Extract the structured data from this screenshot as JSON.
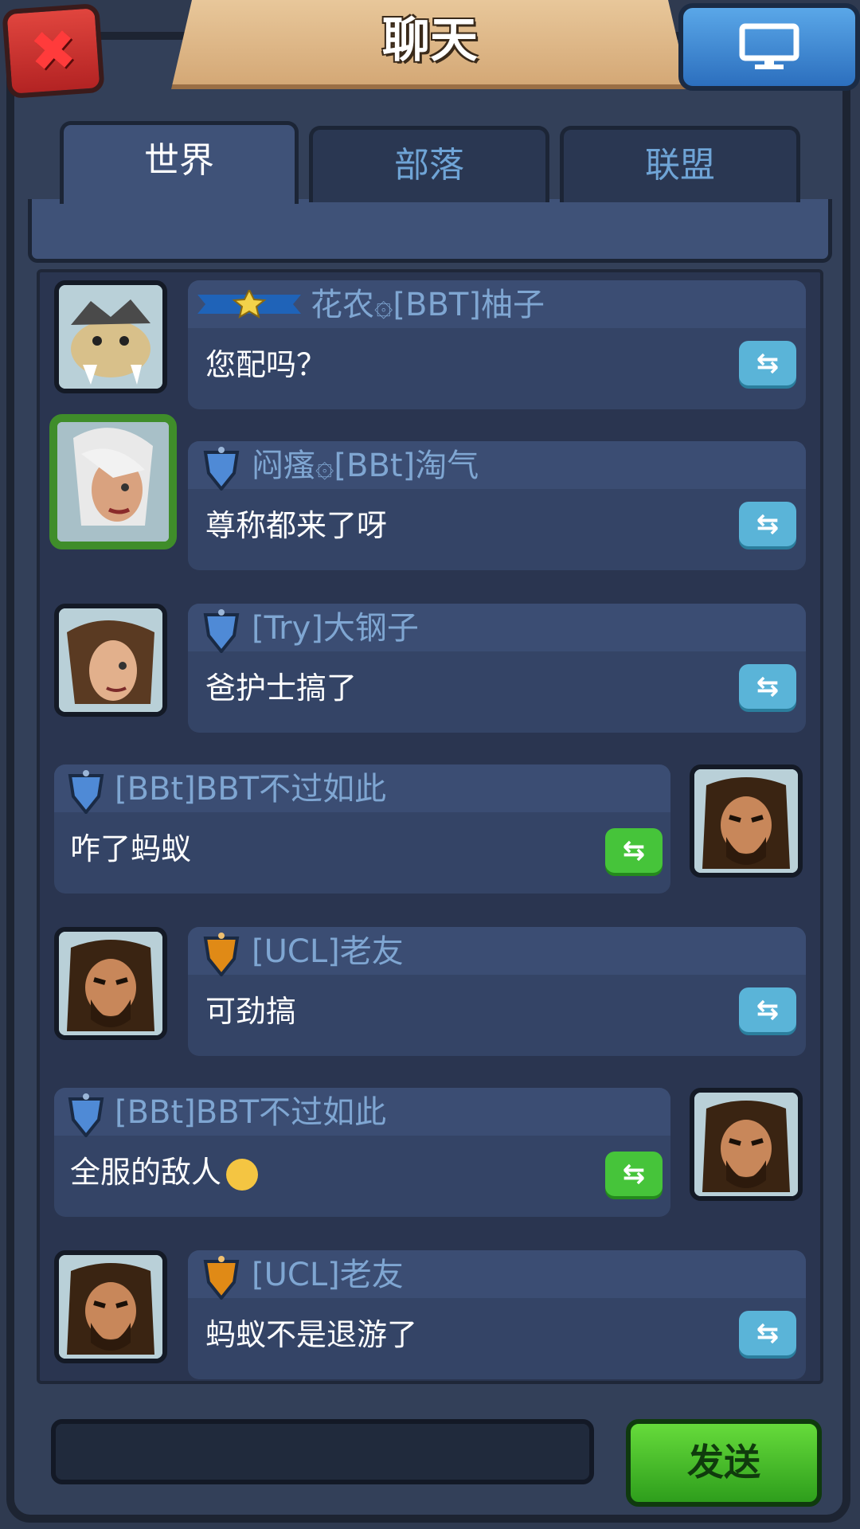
{
  "header": {
    "title": "聊天"
  },
  "tabs": [
    {
      "label": "世界",
      "active": true
    },
    {
      "label": "部落",
      "active": false
    },
    {
      "label": "联盟",
      "active": false
    }
  ],
  "messages": [
    {
      "name": "花农۞[BBT]柚子",
      "text": "您配吗？",
      "side": "left",
      "avatar": "beast",
      "rank": "star-ribbon",
      "action": "blue"
    },
    {
      "name": "闷瘙۞[BBt]淘气",
      "text": "尊称都来了呀",
      "side": "left",
      "avatar": "girl-leaf",
      "rank": "blue-shield",
      "action": "blue"
    },
    {
      "name": "[Try]大钢子",
      "text": "爸护士搞了",
      "side": "left",
      "avatar": "girl-brown",
      "rank": "blue-shield",
      "action": "blue"
    },
    {
      "name": "[BBt]BBT不过如此",
      "text": "咋了蚂蚁",
      "side": "right",
      "avatar": "barbarian",
      "rank": "blue-shield",
      "action": "green"
    },
    {
      "name": "[UCL]老友",
      "text": "可劲搞",
      "side": "left",
      "avatar": "barbarian",
      "rank": "orange-shield",
      "action": "blue"
    },
    {
      "name": "[BBt]BBT不过如此",
      "text": "全服的敌人",
      "side": "right",
      "avatar": "barbarian",
      "rank": "blue-shield",
      "action": "green",
      "emoji": "sad-face"
    },
    {
      "name": "[UCL]老友",
      "text": "蚂蚁不是退游了",
      "side": "left",
      "avatar": "barbarian",
      "rank": "orange-shield",
      "action": "blue"
    }
  ],
  "composer": {
    "input_value": "",
    "send_label": "发送"
  }
}
